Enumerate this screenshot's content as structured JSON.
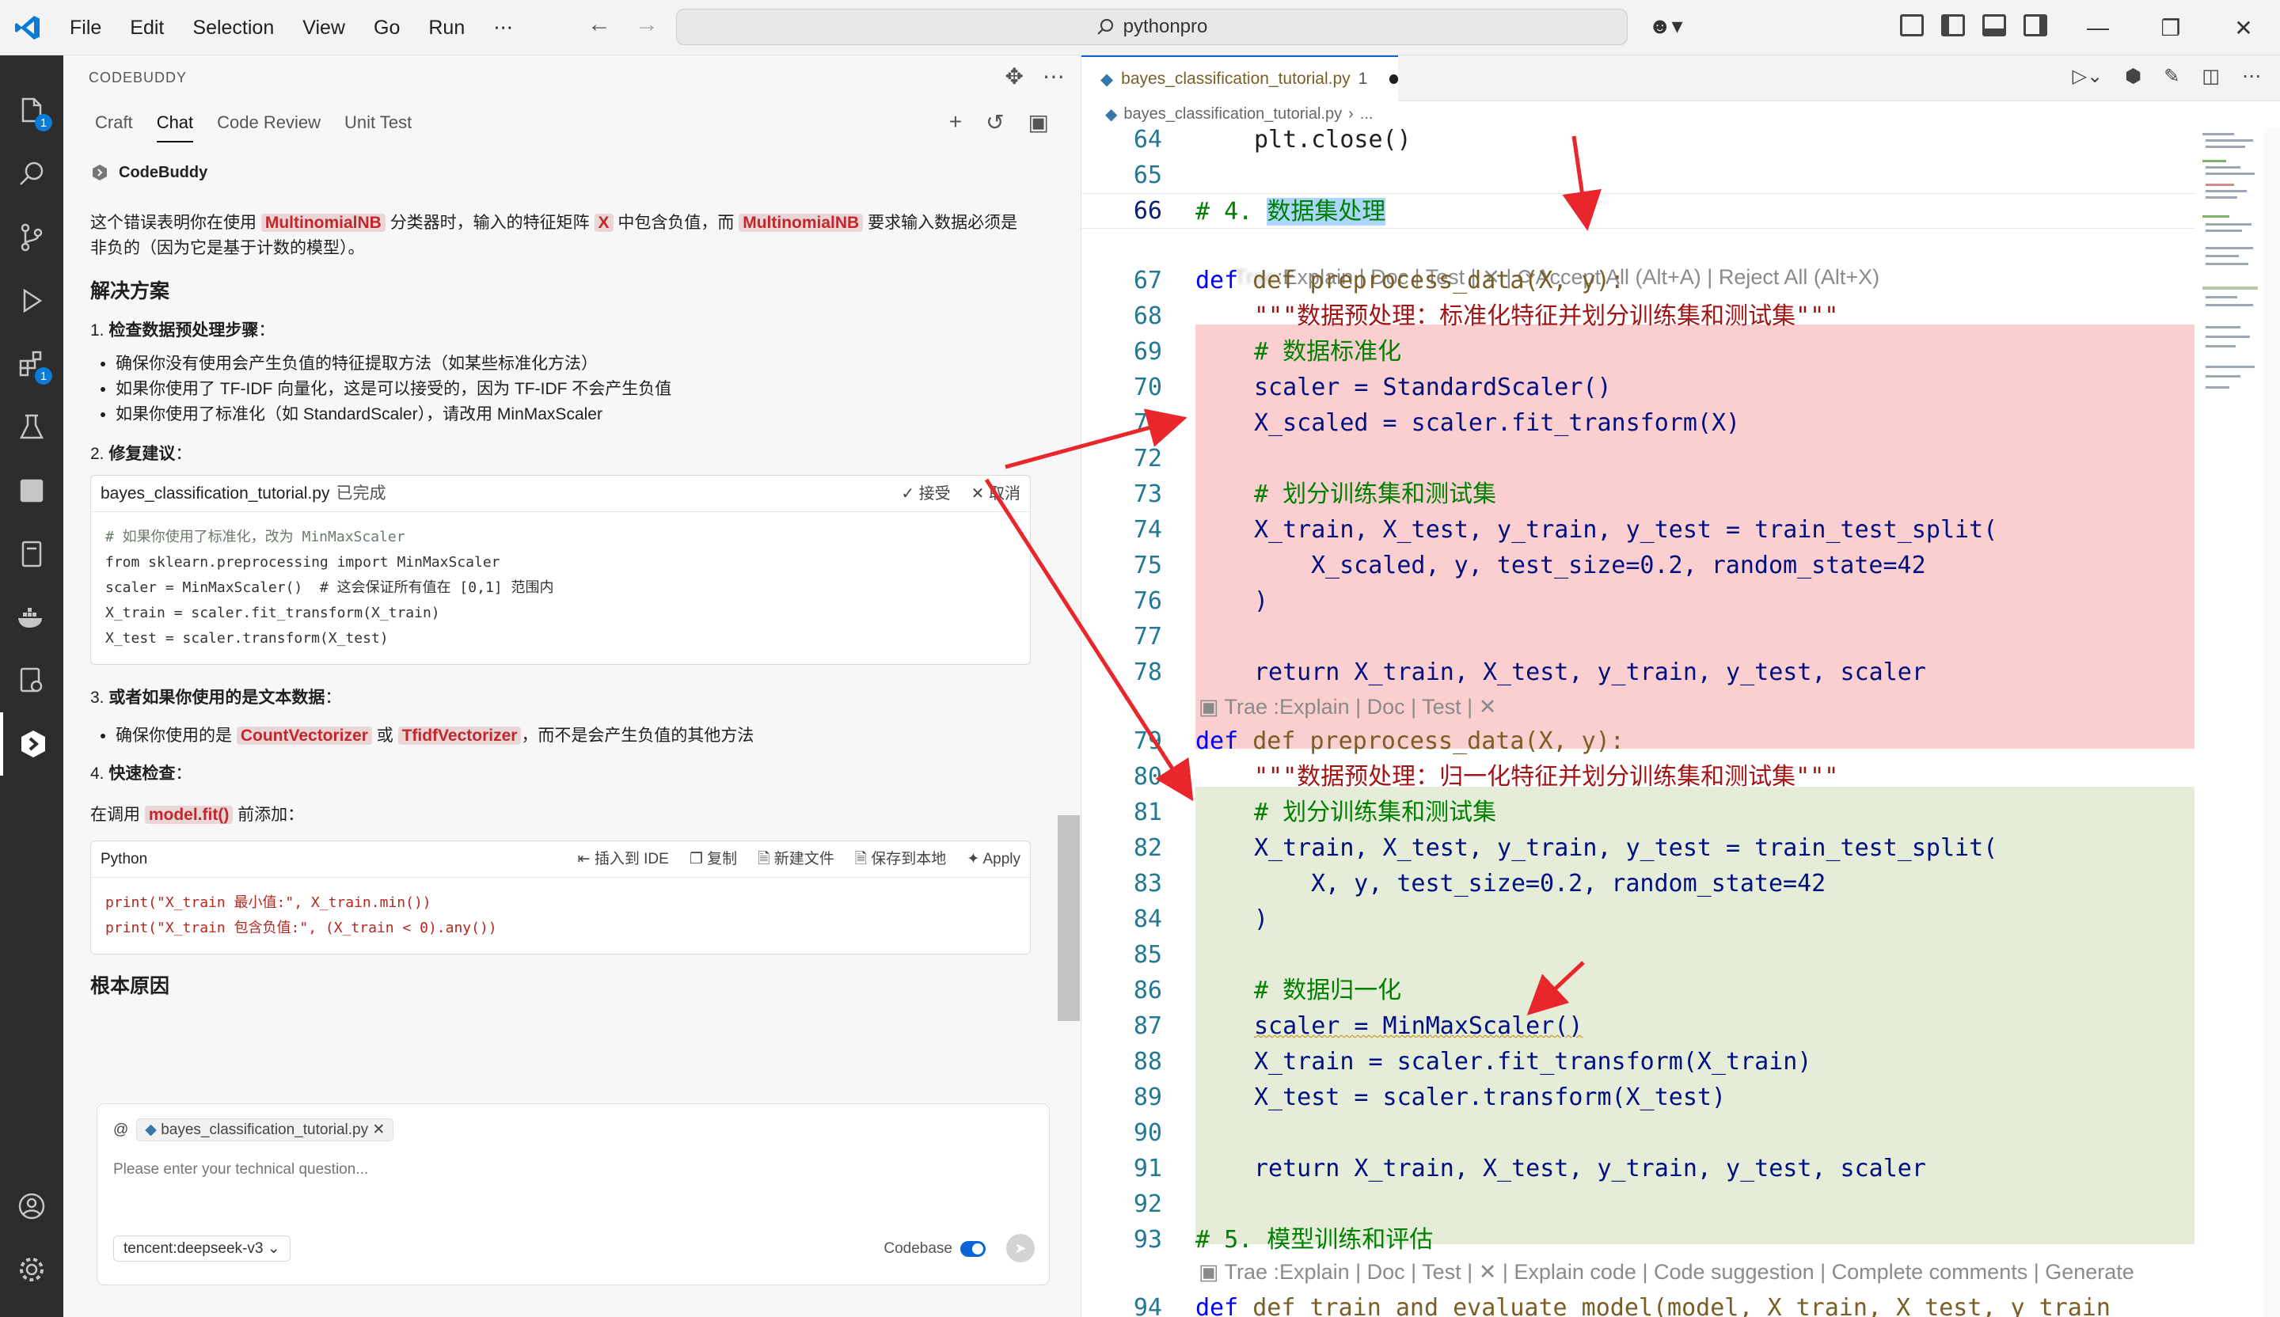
{
  "menu": [
    "File",
    "Edit",
    "Selection",
    "View",
    "Go",
    "Run",
    "⋯"
  ],
  "search": "pythonpro",
  "activity_badges": {
    "explorer": "1",
    "extensions": "1"
  },
  "panel": {
    "header": "CODEBUDDY",
    "tabs": [
      "Craft",
      "Chat",
      "Code Review",
      "Unit Test"
    ],
    "sender": "CodeBuddy",
    "intro_1": "这个错误表明你在使用",
    "intro_kw1": "MultinomialNB",
    "intro_2": "分类器时，输入的特征矩阵",
    "intro_kw2": "X",
    "intro_3": "中包含负值，而",
    "intro_kw3": "MultinomialNB",
    "intro_4": "要求输入数据必须是非负的（因为它是基于计数的模型）。",
    "solution_heading": "解决方案",
    "step1_num": "1. ",
    "step1": "检查数据预处理步骤",
    "step1_colon": "：",
    "step1_bullets": [
      "确保你没有使用会产生负值的特征提取方法（如某些标准化方法）",
      "如果你使用了 TF-IDF 向量化，这是可以接受的，因为 TF-IDF 不会产生负值",
      "如果你使用了标准化（如 StandardScaler），请改用 MinMaxScaler"
    ],
    "step2_num": "2. ",
    "step2": "修复建议",
    "step2_colon": "：",
    "card1": {
      "file": "bayes_classification_tutorial.py",
      "status": "已完成",
      "accept": "接受",
      "reject": "取消",
      "lines": [
        "# 如果你使用了标准化，改为 MinMaxScaler",
        "from sklearn.preprocessing import MinMaxScaler",
        "",
        "scaler = MinMaxScaler()  # 这会保证所有值在 [0,1] 范围内",
        "X_train = scaler.fit_transform(X_train)",
        "X_test = scaler.transform(X_test)"
      ]
    },
    "step3_num": "3. ",
    "step3": "或者如果你使用的是文本数据",
    "step3_colon": "：",
    "step3_pre": "确保你使用的是",
    "step3_kw1": "CountVectorizer",
    "step3_mid": "或",
    "step3_kw2": "TfidfVectorizer",
    "step3_post": "，而不是会产生负值的其他方法",
    "step4_num": "4. ",
    "step4": "快速检查",
    "step4_colon": "：",
    "step4_pre": "在调用",
    "step4_kw": "model.fit()",
    "step4_post": "前添加：",
    "card2": {
      "lang": "Python",
      "insert": "插入到 IDE",
      "copy": "复制",
      "newfile": "新建文件",
      "save": "保存到本地",
      "apply": "Apply",
      "lines": [
        "print(\"X_train 最小值:\", X_train.min())",
        "print(\"X_train 包含负值:\", (X_train < 0).any())"
      ]
    },
    "root_heading": "根本原因",
    "chat": {
      "at": "@",
      "chip": "bayes_classification_tutorial.py",
      "placeholder": "Please enter your technical question...",
      "model": "tencent:deepseek-v3",
      "codebase": "Codebase"
    }
  },
  "editor": {
    "tab_file": "bayes_classification_tutorial.py",
    "tab_count": "1",
    "breadcrumb": "bayes_classification_tutorial.py",
    "breadcrumb_more": "...",
    "lens_accept": "Accept All (Alt+A) | Reject All (Alt+X)",
    "lens_trae": "Trae :Explain | Doc | Test | ✕",
    "lens_trae_full": "Trae :Explain | Doc | Test | ✕ | Explain code | Code suggestion | Complete comments | Generate",
    "lens_first": ":Explain | Doc | Test | ✕ |",
    "lines": {
      "64": "plt.close()",
      "66a": "# 4. ",
      "66b": "数据集处理",
      "67": "def preprocess_data(X, y):",
      "68": "\"\"\"数据预处理：标准化特征并划分训练集和测试集\"\"\"",
      "69": "# 数据标准化",
      "70": "scaler = StandardScaler()",
      "71": "X_scaled = scaler.fit_transform(X)",
      "73": "# 划分训练集和测试集",
      "74": "X_train, X_test, y_train, y_test = train_test_split(",
      "75": "X_scaled, y, test_size=0.2, random_state=42",
      "76": ")",
      "78": "return X_train, X_test, y_train, y_test, scaler",
      "79": "def preprocess_data(X, y):",
      "80": "\"\"\"数据预处理：归一化特征并划分训练集和测试集\"\"\"",
      "81": "# 划分训练集和测试集",
      "82": "X_train, X_test, y_train, y_test = train_test_split(",
      "83": "X, y, test_size=0.2, random_state=42",
      "84": ")",
      "86": "# 数据归一化",
      "87": "scaler = MinMaxScaler()",
      "88": "X_train = scaler.fit_transform(X_train)",
      "89": "X_test = scaler.transform(X_test)",
      "91": "return X_train, X_test, y_train, y_test, scaler",
      "93": "# 5. 模型训练和评估",
      "94": "def train_and_evaluate_model(model, X_train, X_test, y_train"
    },
    "line_numbers": [
      "64",
      "65",
      "66",
      "67",
      "68",
      "69",
      "70",
      "71",
      "72",
      "73",
      "74",
      "75",
      "76",
      "77",
      "78",
      "79",
      "80",
      "81",
      "82",
      "83",
      "84",
      "85",
      "86",
      "87",
      "88",
      "89",
      "90",
      "91",
      "92",
      "93",
      "94"
    ]
  },
  "colors": {
    "accent": "#0a64d6",
    "deleted_bg": "#fbcfcf",
    "inserted_bg": "#e5ecd8",
    "annotation_arrow": "#e8262b",
    "keyword_highlight": "#c1272d"
  }
}
